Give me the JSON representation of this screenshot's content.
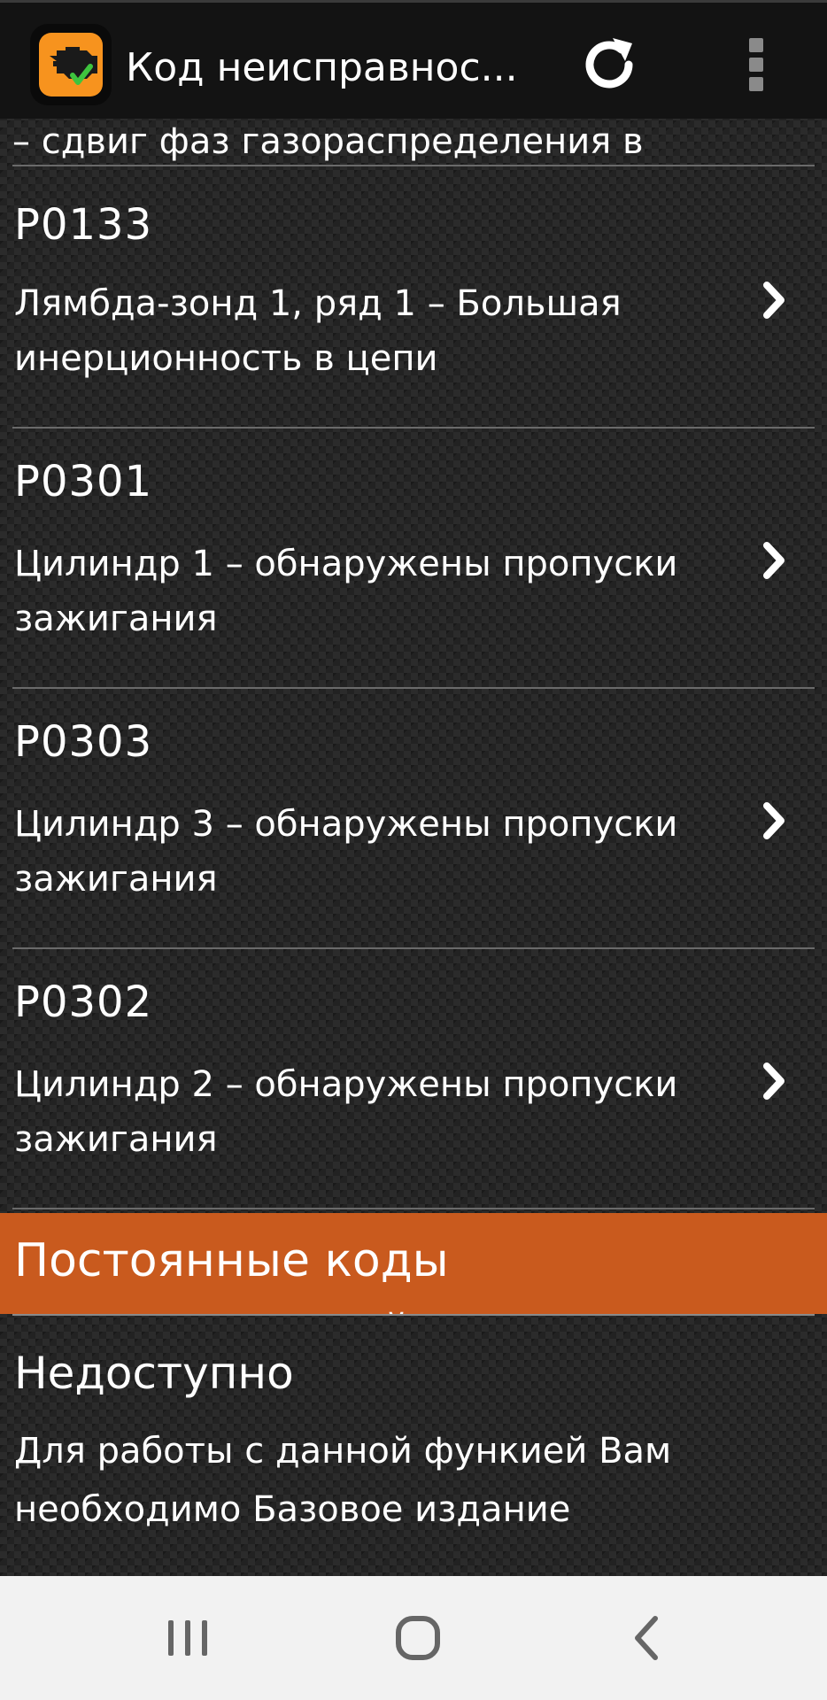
{
  "appbar": {
    "title": "Код неисправнос...",
    "icon": "check-engine-icon",
    "refresh_icon": "refresh-icon",
    "menu_icon": "overflow-menu-icon"
  },
  "partial_text": "– сдвиг фаз газораспределения в",
  "codes": [
    {
      "code": "P0133",
      "description": "Лямбда-зонд 1, ряд 1 – Большая инерционность в цепи"
    },
    {
      "code": "P0301",
      "description": "Цилиндр 1 – обнаружены пропуски зажигания"
    },
    {
      "code": "P0303",
      "description": "Цилиндр 3 – обнаружены пропуски зажигания"
    },
    {
      "code": "P0302",
      "description": "Цилиндр 2 – обнаружены пропуски зажигания"
    }
  ],
  "section": {
    "title": "Постоянные коды неисправностей"
  },
  "unavailable": {
    "title": "Недоступно",
    "description": "Для работы с данной функией Вам необходимо Базовое издание"
  },
  "navbar": {
    "recents_icon": "recents-icon",
    "home_icon": "home-icon",
    "back_icon": "back-icon"
  },
  "colors": {
    "accent": "#c95a1e",
    "appbar_bg": "#131313",
    "icon_orange": "#f7931e"
  }
}
